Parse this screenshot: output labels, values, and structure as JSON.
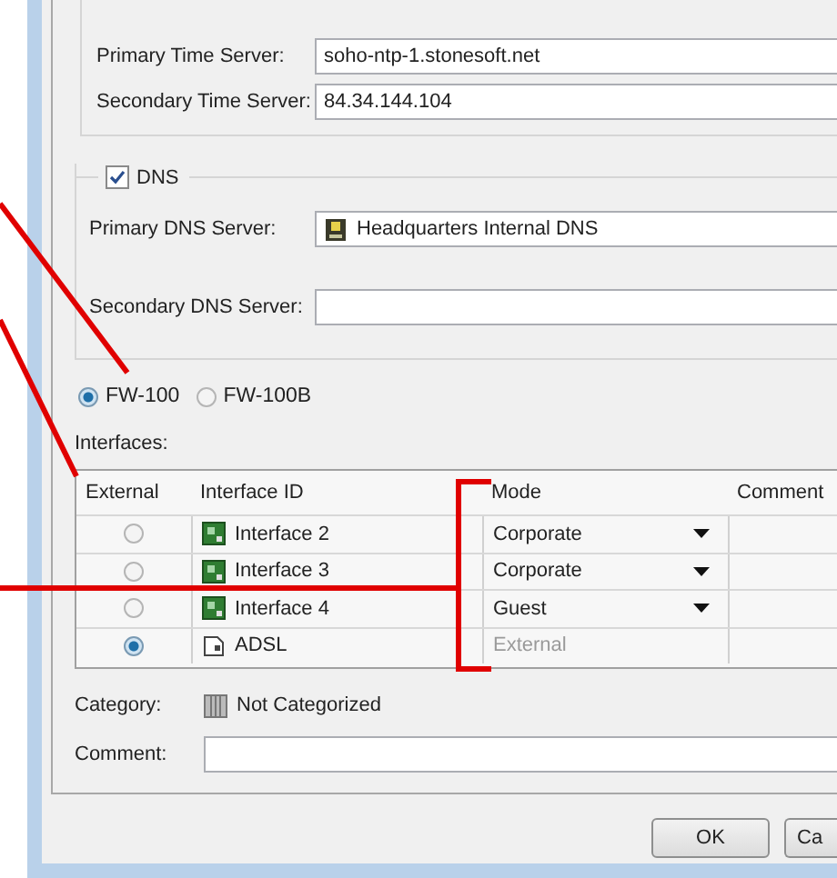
{
  "time_settings": {
    "fields": [
      {
        "label": "Primary Time Server:",
        "value": "soho-ntp-1.stonesoft.net"
      },
      {
        "label": "Secondary Time Server:",
        "value": "84.34.144.104"
      }
    ]
  },
  "dns": {
    "label": "DNS",
    "checked": true,
    "fields": [
      {
        "label": "Primary DNS Server:",
        "value": "Headquarters Internal DNS",
        "kind": "element"
      },
      {
        "label": "Secondary DNS Server:",
        "kind": "text"
      }
    ]
  },
  "models": [
    {
      "label": "FW-100",
      "selected": true
    },
    {
      "label": "FW-100B",
      "selected": false
    }
  ],
  "interfaces": {
    "label": "Interfaces:",
    "columns": [
      "External",
      "Interface ID",
      "Mode",
      "Comment"
    ],
    "rows": [
      {
        "selected": false,
        "id": "Interface 2",
        "kind": "switch",
        "mode": "Corporate",
        "disabled": false
      },
      {
        "selected": false,
        "id": "Interface 3",
        "kind": "switch",
        "mode": "Corporate",
        "disabled": false
      },
      {
        "selected": false,
        "id": "Interface 4",
        "kind": "switch",
        "mode": "Guest",
        "disabled": false
      },
      {
        "selected": true,
        "id": "ADSL",
        "kind": "adsl",
        "mode": "External",
        "disabled": true
      }
    ]
  },
  "category": {
    "label": "Category:",
    "value": "Not Categorized"
  },
  "comment": {
    "label": "Comment:"
  },
  "buttons": [
    "OK",
    "Ca"
  ]
}
